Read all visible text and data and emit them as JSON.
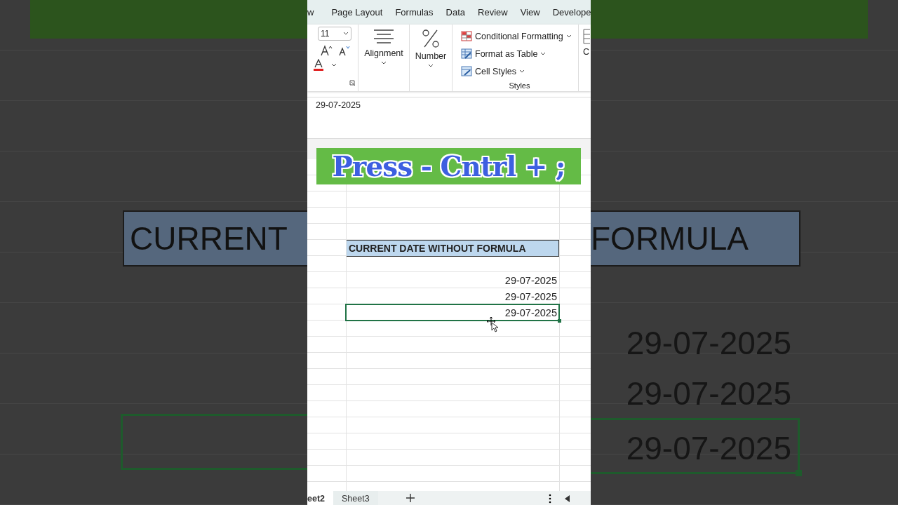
{
  "backdrop": {
    "left": {
      "header_text": "CURRENT"
    },
    "right": {
      "header_text": "FORMULA",
      "dates": [
        "29-07-2025",
        "29-07-2025",
        "29-07-2025"
      ]
    }
  },
  "ribbon": {
    "tabs": [
      "w",
      "Page Layout",
      "Formulas",
      "Data",
      "Review",
      "View",
      "Develope"
    ],
    "font_size": "11",
    "alignment_label": "Alignment",
    "number_label": "Number",
    "styles_commands": [
      "Conditional Formatting",
      "Format as Table",
      "Cell Styles"
    ],
    "styles_label": "Styles",
    "cut_label": "C"
  },
  "formula_bar": {
    "value": "29-07-2025"
  },
  "overlay_banner": {
    "text": "Press - Cntrl + ;"
  },
  "sheet": {
    "header": "CURRENT DATE WITHOUT FORMULA",
    "dates": [
      {
        "value": "29-07-2025",
        "selected": false
      },
      {
        "value": "29-07-2025",
        "selected": false
      },
      {
        "value": "29-07-2025",
        "selected": true
      }
    ]
  },
  "sheet_tabs": [
    {
      "label": "eet2",
      "selected": true
    },
    {
      "label": "Sheet3",
      "selected": false
    }
  ]
}
